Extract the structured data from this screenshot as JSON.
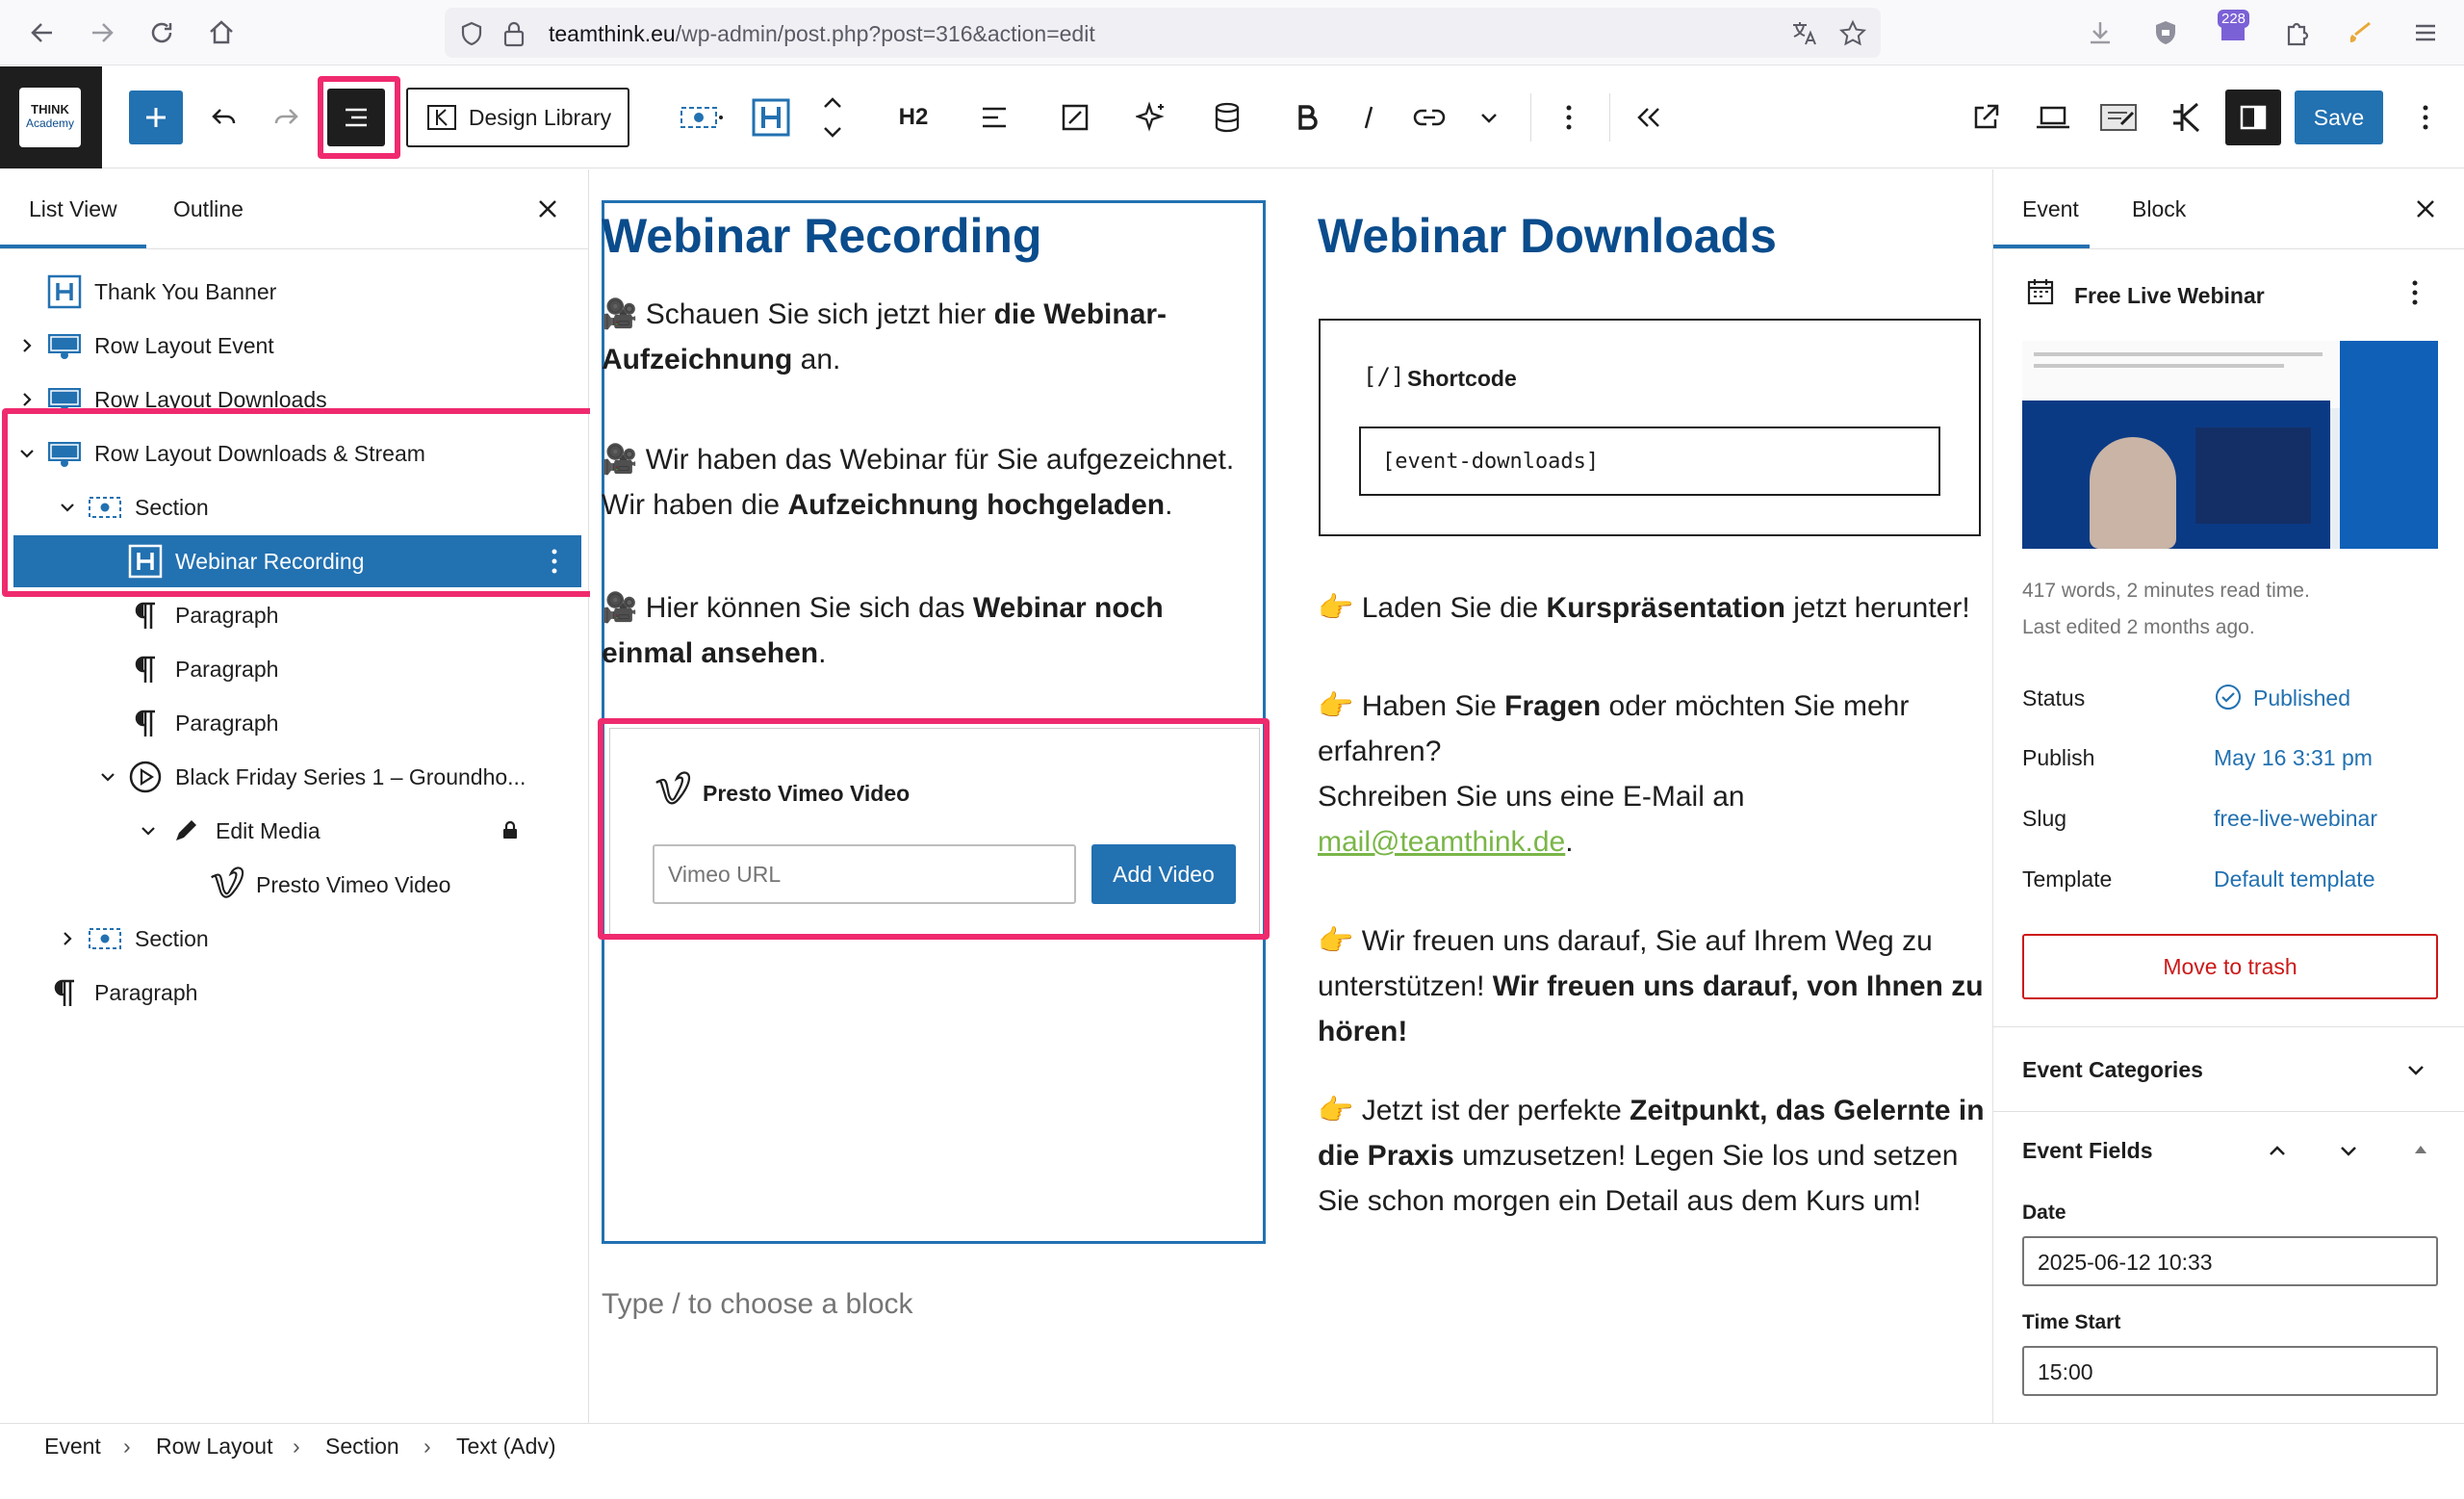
{
  "browser": {
    "url_domain": "teamthink.eu",
    "url_path": "/wp-admin/post.php?post=316&action=edit",
    "notification_count": "228"
  },
  "toolbar": {
    "logo_line1": "THINK",
    "logo_line2": "Academy",
    "design_library_label": "Design Library",
    "heading_level_label": "H2",
    "save_label": "Save"
  },
  "left_panel": {
    "tabs": [
      "List View",
      "Outline"
    ],
    "items": [
      {
        "label": "Thank You Banner",
        "icon": "heading-icon",
        "depth": 0,
        "chevron": "none"
      },
      {
        "label": "Row Layout Event",
        "icon": "row-layout-icon",
        "depth": 0,
        "chevron": "right"
      },
      {
        "label": "Row Layout Downloads",
        "icon": "row-layout-icon",
        "depth": 0,
        "chevron": "right"
      },
      {
        "label": "Row Layout Downloads & Stream",
        "icon": "row-layout-icon",
        "depth": 0,
        "chevron": "down"
      },
      {
        "label": "Section",
        "icon": "section-icon",
        "depth": 1,
        "chevron": "down"
      },
      {
        "label": "Webinar Recording",
        "icon": "heading-icon",
        "depth": 2,
        "chevron": "none",
        "selected": true
      },
      {
        "label": "Paragraph",
        "icon": "paragraph-icon",
        "depth": 2,
        "chevron": "none"
      },
      {
        "label": "Paragraph",
        "icon": "paragraph-icon",
        "depth": 2,
        "chevron": "none"
      },
      {
        "label": "Paragraph",
        "icon": "paragraph-icon",
        "depth": 2,
        "chevron": "none"
      },
      {
        "label": "Black Friday Series 1 – Groundho...",
        "icon": "play-icon",
        "depth": 2,
        "chevron": "down"
      },
      {
        "label": "Edit Media",
        "icon": "pencil-icon",
        "depth": 3,
        "chevron": "down",
        "locked": true
      },
      {
        "label": "Presto Vimeo Video",
        "icon": "vimeo-icon",
        "depth": 4,
        "chevron": "none"
      },
      {
        "label": "Section",
        "icon": "section-icon",
        "depth": 1,
        "chevron": "right"
      },
      {
        "label": "Paragraph",
        "icon": "paragraph-icon",
        "depth": 0,
        "chevron": "none"
      }
    ]
  },
  "canvas": {
    "left_heading": "Webinar Recording",
    "p1_a": "Schauen Sie sich jetzt hier ",
    "p1_b": "die Webinar-Aufzeichnung",
    "p1_c": " an.",
    "p2_a": "Wir haben das Webinar für Sie aufgezeichnet. Wir haben die ",
    "p2_b": "Aufzeichnung hochgeladen",
    "p2_c": ".",
    "p3_a": "Hier können Sie sich das ",
    "p3_b": "Webinar noch einmal ansehen",
    "p3_c": ".",
    "vimeo_title": "Presto Vimeo Video",
    "vimeo_placeholder": "Vimeo URL",
    "add_video_label": "Add Video",
    "right_heading": "Webinar Downloads",
    "shortcode_title": "Shortcode",
    "shortcode_icon": "[/]",
    "shortcode_value": "[event-downloads]",
    "r1_a": "Laden Sie die ",
    "r1_b": "Kurspräsentation",
    "r1_c": " jetzt herunter!",
    "r2_a": "Haben Sie ",
    "r2_b": "Fragen",
    "r2_c": " oder möchten Sie mehr erfahren?",
    "r2_d": "Schreiben Sie uns eine E-Mail an",
    "r2_link": "mail@teamthink.de",
    "r2_e": ".",
    "r3_a": "Wir freuen uns darauf, Sie auf Ihrem Weg zu unterstützen! ",
    "r3_b": "Wir freuen uns darauf, von Ihnen zu hören!",
    "r4_a": "Jetzt ist der perfekte ",
    "r4_b": "Zeitpunkt, das Gelernte in die Praxis",
    "r4_c": " umzusetzen! Legen Sie los und setzen Sie schon morgen ein Detail aus dem Kurs um!",
    "block_placeholder": "Type / to choose a block"
  },
  "right_panel": {
    "tabs": [
      "Event",
      "Block"
    ],
    "post_title": "Free Live Webinar",
    "words": "417 words, 2 minutes read time.",
    "last_edited": "Last edited 2 months ago.",
    "status_label": "Status",
    "status_value": "Published",
    "publish_label": "Publish",
    "publish_value": "May 16 3:31 pm",
    "slug_label": "Slug",
    "slug_value": "free-live-webinar",
    "template_label": "Template",
    "template_value": "Default template",
    "trash_label": "Move to trash",
    "event_categories": "Event Categories",
    "event_fields": "Event Fields",
    "date_label": "Date",
    "date_value": "2025-06-12 10:33",
    "time_start_label": "Time Start",
    "time_start_value": "15:00"
  },
  "footer": {
    "breadcrumbs": [
      "Event",
      "Row Layout",
      "Section",
      "Text (Adv)"
    ]
  },
  "colors": {
    "accent": "#2271b1",
    "heading": "#0a4c8c",
    "highlight": "#ef2a6e",
    "trash": "#cc1818",
    "link_green": "#7ab648"
  }
}
